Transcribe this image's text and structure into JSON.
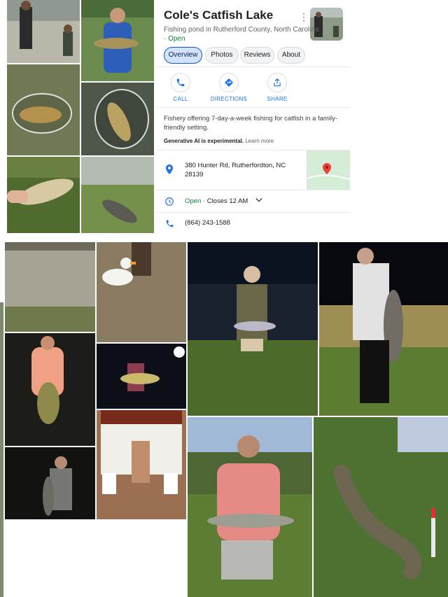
{
  "place": {
    "title": "Cole's Catfish Lake",
    "subtitle": "Fishing pond in Rutherford County, North Carolina",
    "separator": "·",
    "open_status": "Open"
  },
  "tabs": [
    {
      "label": "Overview",
      "active": true
    },
    {
      "label": "Photos",
      "active": false
    },
    {
      "label": "Reviews",
      "active": false
    },
    {
      "label": "About",
      "active": false
    }
  ],
  "actions": [
    {
      "label": "CALL",
      "icon": "phone-icon"
    },
    {
      "label": "DIRECTIONS",
      "icon": "directions-icon"
    },
    {
      "label": "SHARE",
      "icon": "share-icon"
    }
  ],
  "description": "Fishery offering 7-day-a-week fishing for catfish in a family-friendly setting.",
  "ai_note": {
    "bold": "Generative AI is experimental.",
    "link": "Learn more"
  },
  "address": {
    "line1": "380 Hunter Rd, Rutherfordton, NC",
    "line2": "28139"
  },
  "hours": {
    "status": "Open",
    "sep": "·",
    "closes": "Closes 12 AM"
  },
  "phone": "(864) 243-1588",
  "colors": {
    "accent": "#1a73e8",
    "open_green": "#188038",
    "map_pin": "#ea4335",
    "chip_active": "#d3e3fd"
  },
  "icons": [
    "more-vert-icon",
    "location-pin-icon",
    "clock-icon",
    "phone-icon",
    "chevron-down-icon",
    "map-pin-icon"
  ]
}
